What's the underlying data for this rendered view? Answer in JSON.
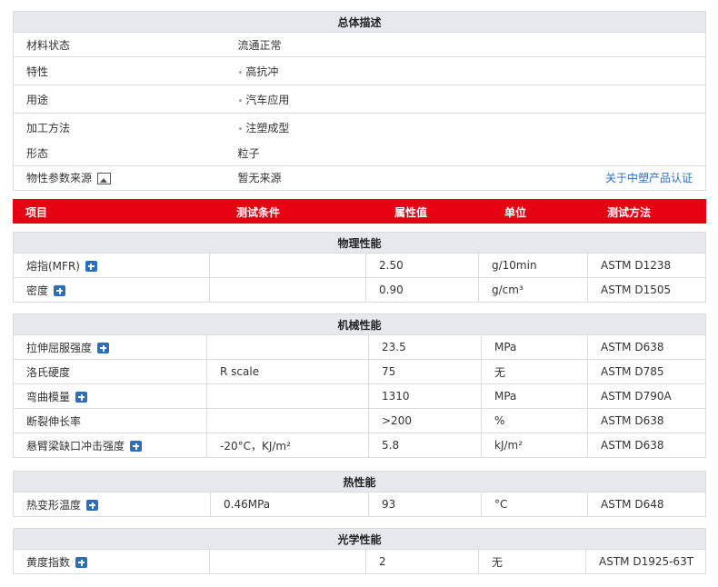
{
  "general": {
    "title": "总体描述",
    "rows": [
      {
        "label": "材料状态",
        "value": "流通正常"
      },
      {
        "label": "特性",
        "value": "高抗冲",
        "bullet": "•"
      },
      {
        "label": "用途",
        "value": "汽车应用",
        "bullet": "•"
      },
      {
        "label": "加工方法",
        "value": "注塑成型",
        "bullet": "•"
      },
      {
        "label": "形态",
        "value": "粒子"
      },
      {
        "label": "物性参数来源",
        "value": "暂无来源",
        "link": "关于中塑产品认证"
      }
    ]
  },
  "header": {
    "item": "项目",
    "condition": "测试条件",
    "value": "属性值",
    "unit": "单位",
    "method": "测试方法"
  },
  "sections": [
    {
      "title": "物理性能",
      "rows": [
        {
          "item": "熔指(MFR)",
          "condition": "",
          "value": "2.50",
          "unit": "g/10min",
          "method": "ASTM D1238"
        },
        {
          "item": "密度",
          "condition": "",
          "value": "0.90",
          "unit": "g/cm³",
          "method": "ASTM D1505"
        }
      ]
    },
    {
      "title": "机械性能",
      "rows": [
        {
          "item": "拉伸屈服强度",
          "condition": "",
          "value": "23.5",
          "unit": "MPa",
          "method": "ASTM D638"
        },
        {
          "item": "洛氏硬度",
          "condition": "R scale",
          "value": "75",
          "unit": "无",
          "method": "ASTM D785"
        },
        {
          "item": "弯曲模量",
          "condition": "",
          "value": "1310",
          "unit": "MPa",
          "method": "ASTM D790A"
        },
        {
          "item": "断裂伸长率",
          "condition": "",
          "value": ">200",
          "unit": "%",
          "method": "ASTM D638"
        },
        {
          "item": "悬臂梁缺口冲击强度",
          "condition": "-20°C，KJ/m²",
          "value": "5.8",
          "unit": "kJ/m²",
          "method": "ASTM D638"
        }
      ]
    },
    {
      "title": "热性能",
      "rows": [
        {
          "item": "热变形温度",
          "condition": "0.46MPa",
          "value": "93",
          "unit": "°C",
          "method": "ASTM D648"
        }
      ]
    },
    {
      "title": "光学性能",
      "rows": [
        {
          "item": "黄度指数",
          "condition": "",
          "value": "2",
          "unit": "无",
          "method": "ASTM D1925-63T"
        }
      ]
    }
  ]
}
